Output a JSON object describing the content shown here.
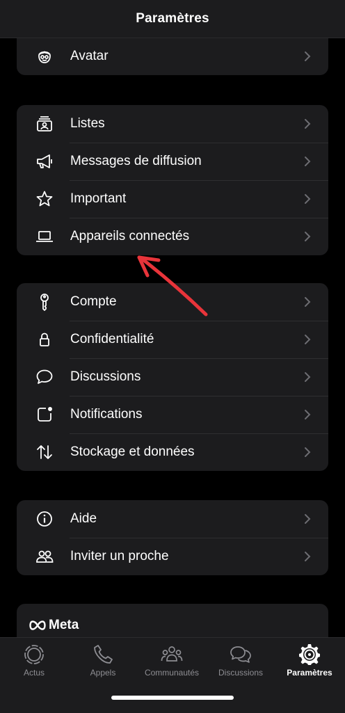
{
  "header": {
    "title": "Paramètres"
  },
  "groups": [
    {
      "items": [
        {
          "label": "Avatar",
          "icon": "avatar-icon"
        }
      ]
    },
    {
      "items": [
        {
          "label": "Listes",
          "icon": "lists-icon"
        },
        {
          "label": "Messages de diffusion",
          "icon": "megaphone-icon"
        },
        {
          "label": "Important",
          "icon": "star-icon"
        },
        {
          "label": "Appareils connectés",
          "icon": "laptop-icon"
        }
      ]
    },
    {
      "items": [
        {
          "label": "Compte",
          "icon": "key-icon"
        },
        {
          "label": "Confidentialité",
          "icon": "lock-icon"
        },
        {
          "label": "Discussions",
          "icon": "chat-bubble-icon"
        },
        {
          "label": "Notifications",
          "icon": "notification-icon"
        },
        {
          "label": "Stockage et données",
          "icon": "data-arrows-icon"
        }
      ]
    },
    {
      "items": [
        {
          "label": "Aide",
          "icon": "info-icon"
        },
        {
          "label": "Inviter un proche",
          "icon": "people-icon"
        }
      ]
    }
  ],
  "meta": {
    "label": "Meta"
  },
  "tabs": [
    {
      "label": "Actus",
      "icon": "updates-icon",
      "active": false
    },
    {
      "label": "Appels",
      "icon": "phone-icon",
      "active": false
    },
    {
      "label": "Communautés",
      "icon": "communities-icon",
      "active": false
    },
    {
      "label": "Discussions",
      "icon": "chats-icon",
      "active": false
    },
    {
      "label": "Paramètres",
      "icon": "settings-gear-icon",
      "active": true
    }
  ],
  "colors": {
    "background": "#000000",
    "card": "#1c1c1e",
    "annotation_arrow": "#e8343a",
    "inactive_tab": "#8e8e93"
  }
}
